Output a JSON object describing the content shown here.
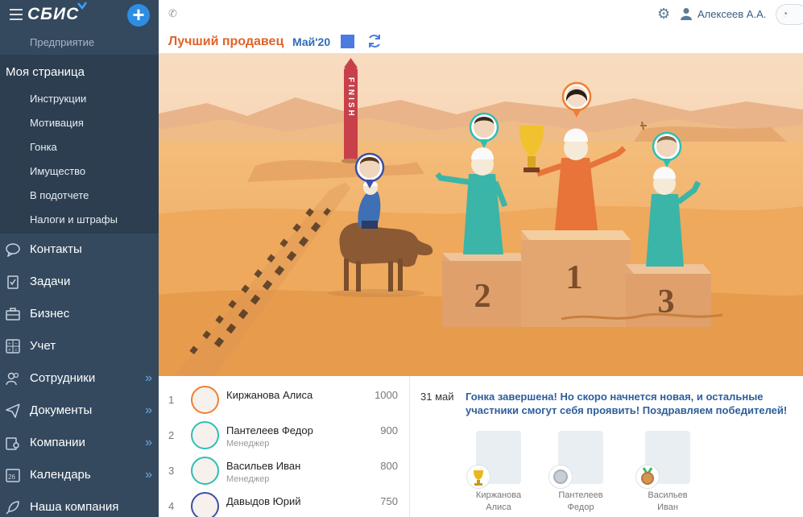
{
  "sidebar": {
    "logo": "СБИС",
    "org": "Предприятие",
    "my_page": "Моя страница",
    "sub_items": [
      "Инструкции",
      "Мотивация",
      "Гонка",
      "Имущество",
      "В подотчете",
      "Налоги и штрафы"
    ],
    "nav": [
      {
        "label": "Контакты",
        "icon": "chat-icon",
        "arrow": ""
      },
      {
        "label": "Задачи",
        "icon": "clipboard-icon",
        "arrow": ""
      },
      {
        "label": "Бизнес",
        "icon": "briefcase-icon",
        "arrow": ""
      },
      {
        "label": "Учет",
        "icon": "calculator-icon",
        "arrow": ""
      },
      {
        "label": "Сотрудники",
        "icon": "people-icon",
        "arrow": "»"
      },
      {
        "label": "Документы",
        "icon": "paper-plane-icon",
        "arrow": "»"
      },
      {
        "label": "Компании",
        "icon": "location-icon",
        "arrow": "»"
      },
      {
        "label": "Календарь",
        "icon": "calendar-icon",
        "calendar_day": "26",
        "arrow": "»"
      },
      {
        "label": "Наша компания",
        "icon": "rocket-icon",
        "arrow": ""
      }
    ]
  },
  "header": {
    "user": "Алексеев А.А."
  },
  "title": {
    "text": "Лучший продавец",
    "period": "Май'20"
  },
  "scene": {
    "finish_label": "FINISH",
    "podium_places": [
      "2",
      "1",
      "3"
    ]
  },
  "ranking": [
    {
      "place": "1",
      "name": "Киржанова Алиса",
      "role": "",
      "score": "1000",
      "ring": "orange"
    },
    {
      "place": "2",
      "name": "Пантелеев Федор",
      "role": "Менеджер",
      "score": "900",
      "ring": "teal"
    },
    {
      "place": "3",
      "name": "Васильев Иван",
      "role": "Менеджер",
      "score": "800",
      "ring": "teal"
    },
    {
      "place": "4",
      "name": "Давыдов Юрий",
      "role": "",
      "score": "750",
      "ring": "navy"
    }
  ],
  "news": {
    "date": "31 май",
    "text": "Гонка завершена! Но скоро начнется новая, и остальные участники смогут себя проявить! Поздравляем победителей!",
    "winners": [
      {
        "first": "Киржанова",
        "last": "Алиса",
        "medal": "gold-cup-icon"
      },
      {
        "first": "Пантелеев",
        "last": "Федор",
        "medal": "silver-medal-icon"
      },
      {
        "first": "Васильев",
        "last": "Иван",
        "medal": "bronze-medal-icon"
      }
    ]
  },
  "colors": {
    "sidebar": "#34495e",
    "title": "#e0632a",
    "accent": "#2e8de3",
    "sand": "#f0b266"
  }
}
